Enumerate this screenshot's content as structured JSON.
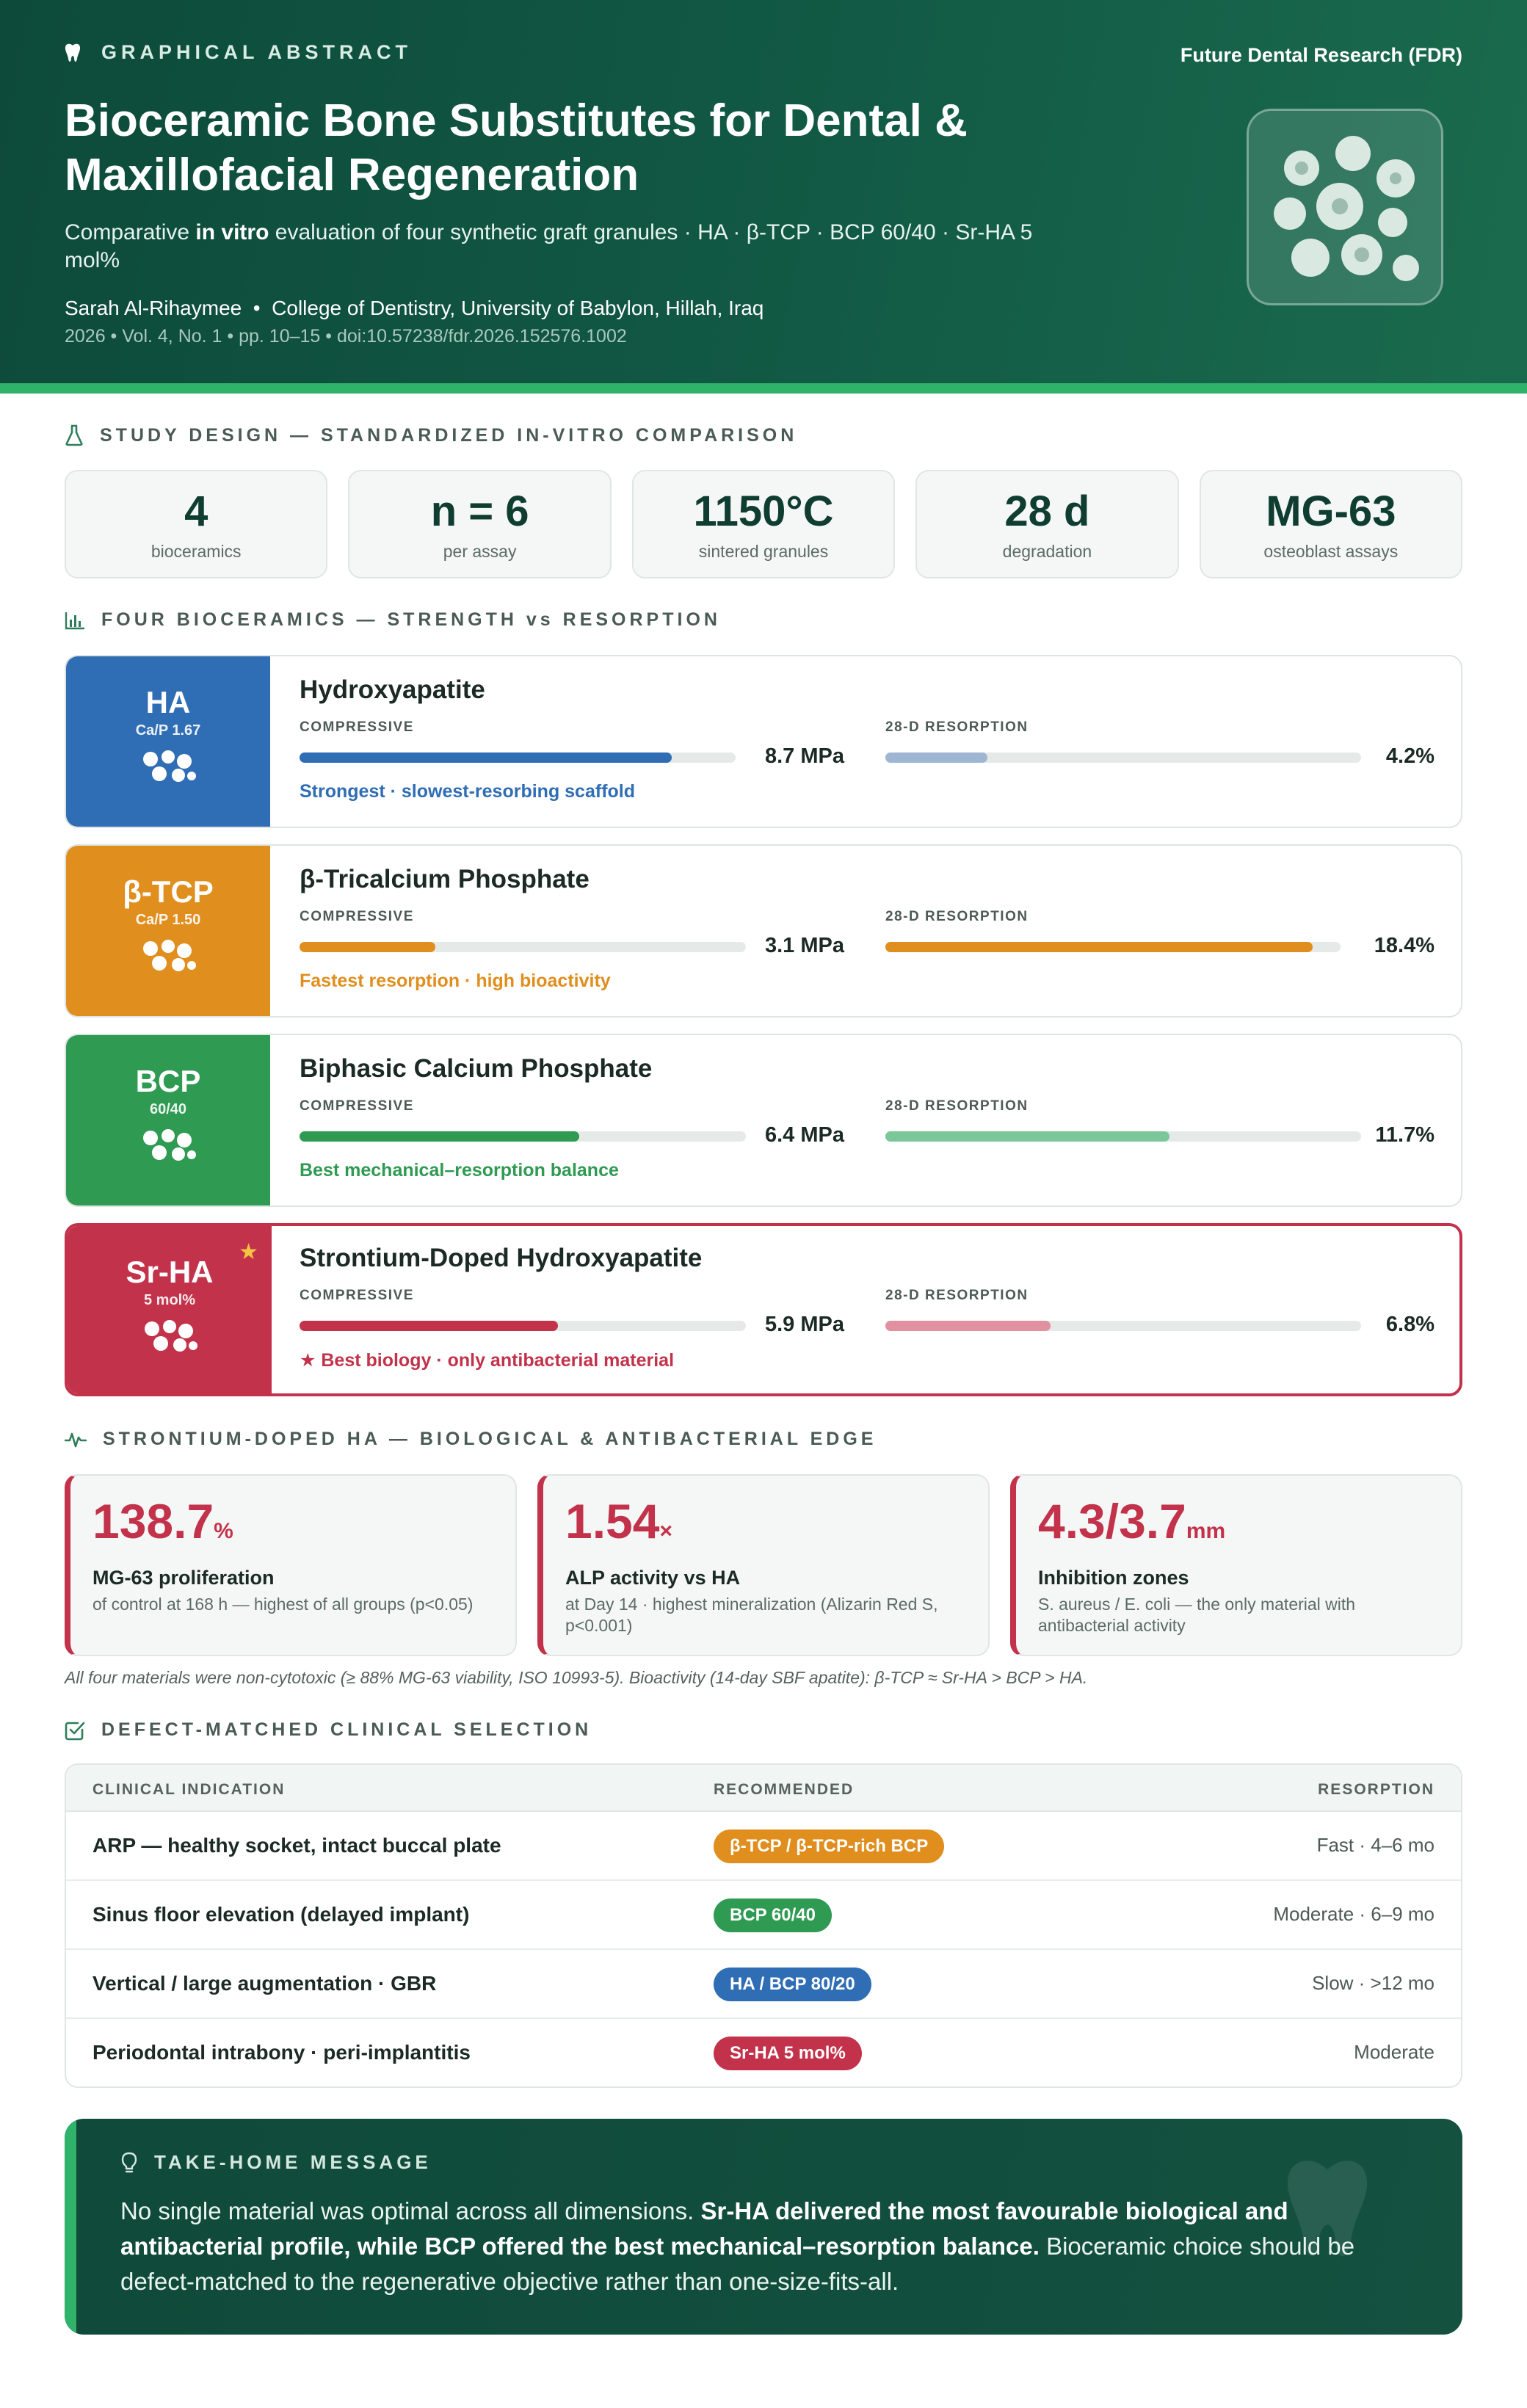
{
  "header": {
    "section_label": "GRAPHICAL ABSTRACT",
    "journal": "Future Dental Research (FDR)",
    "title": "Bioceramic Bone Substitutes for Dental & Maxillofacial Regeneration",
    "subtitle_pre": "Comparative ",
    "subtitle_bold": "in vitro",
    "subtitle_post": " evaluation of four synthetic graft granules  ·  HA · β-TCP · BCP 60/40 · Sr-HA 5 mol%",
    "author": "Sarah Al-Rihaymee",
    "affiliation": "College of Dentistry, University of Babylon, Hillah, Iraq",
    "author_sep": "•",
    "citation": "2026  •  Vol. 4, No. 1  •  pp. 10–15  •  doi:10.57238/fdr.2026.152576.1002"
  },
  "study_design": {
    "heading": "STUDY DESIGN — STANDARDIZED IN-VITRO COMPARISON",
    "stats": [
      {
        "value": "4",
        "label": "bioceramics"
      },
      {
        "value": "n = 6",
        "label": "per assay"
      },
      {
        "value": "1150°C",
        "label": "sintered granules"
      },
      {
        "value": "28 d",
        "label": "degradation"
      },
      {
        "value": "MG-63",
        "label": "osteoblast assays"
      }
    ]
  },
  "materials_section": {
    "heading": "FOUR BIOCERAMICS — STRENGTH vs RESORPTION",
    "compressive_label": "COMPRESSIVE",
    "resorption_label": "28-D RESORPTION"
  },
  "materials": [
    {
      "abbr": "HA",
      "sub": "Ca/P 1.67",
      "name": "Hydroxyapatite",
      "compressive_mpa": 8.7,
      "compressive_text": "8.7 MPa",
      "resorption_pct": 4.2,
      "resorption_text": "4.2%",
      "note": "Strongest · slowest-resorbing scaffold",
      "color": "#2f6db5",
      "light": "#9fb6d2"
    },
    {
      "abbr": "β-TCP",
      "sub": "Ca/P 1.50",
      "name": "β-Tricalcium Phosphate",
      "compressive_mpa": 3.1,
      "compressive_text": "3.1 MPa",
      "resorption_pct": 18.4,
      "resorption_text": "18.4%",
      "note": "Fastest resorption · high bioactivity",
      "color": "#e08e1e",
      "light": "#e08e1e"
    },
    {
      "abbr": "BCP",
      "sub": "60/40",
      "name": "Biphasic Calcium Phosphate",
      "compressive_mpa": 6.4,
      "compressive_text": "6.4 MPa",
      "resorption_pct": 11.7,
      "resorption_text": "11.7%",
      "note": "Best mechanical–resorption balance",
      "color": "#2e9a52",
      "light": "#7cc79a"
    },
    {
      "abbr": "Sr-HA",
      "sub": "5 mol%",
      "name": "Strontium-Doped Hydroxyapatite",
      "compressive_mpa": 5.9,
      "compressive_text": "5.9 MPa",
      "resorption_pct": 6.8,
      "resorption_text": "6.8%",
      "note": "★ Best biology · only antibacterial material",
      "color": "#c3324b",
      "light": "#e0909e",
      "star": "★"
    }
  ],
  "srha_section": {
    "heading": "STRONTIUM-DOPED HA — BIOLOGICAL & ANTIBACTERIAL EDGE",
    "cards": [
      {
        "value": "138.7",
        "unit": "%",
        "title": "MG-63 proliferation",
        "desc": "of control at 168 h — highest of all groups (p<0.05)"
      },
      {
        "value": "1.54",
        "unit": "×",
        "title": "ALP activity vs HA",
        "desc": "at Day 14 · highest mineralization (Alizarin Red S, p<0.001)"
      },
      {
        "value": "4.3/3.7",
        "unit": "mm",
        "title": "Inhibition zones",
        "desc": "S. aureus / E. coli — the only material with antibacterial activity"
      }
    ],
    "footnote": "All four materials were non-cytotoxic (≥ 88% MG-63 viability, ISO 10993-5). Bioactivity (14-day SBF apatite): β-TCP ≈ Sr-HA > BCP > HA."
  },
  "clinical": {
    "heading": "DEFECT-MATCHED CLINICAL SELECTION",
    "columns": [
      "CLINICAL INDICATION",
      "RECOMMENDED",
      "RESORPTION"
    ],
    "rows": [
      {
        "indication": "ARP — healthy socket, intact buccal plate",
        "recommended": "β-TCP / β-TCP-rich BCP",
        "resorption": "Fast · 4–6 mo",
        "color": "#e08e1e"
      },
      {
        "indication": "Sinus floor elevation (delayed implant)",
        "recommended": "BCP 60/40",
        "resorption": "Moderate · 6–9 mo",
        "color": "#2e9a52"
      },
      {
        "indication": "Vertical / large augmentation · GBR",
        "recommended": "HA / BCP 80/20",
        "resorption": "Slow · >12 mo",
        "color": "#2f6db5"
      },
      {
        "indication": "Periodontal intrabony · peri-implantitis",
        "recommended": "Sr-HA 5 mol%",
        "resorption": "Moderate",
        "color": "#c3324b"
      }
    ]
  },
  "takehome": {
    "heading": "TAKE-HOME MESSAGE",
    "pre": "No single material was optimal across all dimensions. ",
    "bold": "Sr-HA delivered the most favourable biological and antibacterial profile, while BCP offered the best mechanical–resorption balance.",
    "post": " Bioceramic choice should be defect-matched to the regenerative objective rather than one-size-fits-all."
  },
  "colors": {
    "brand_dark": "#0d4a3a",
    "brand_accent": "#2fb26a",
    "highlight": "#c3324b"
  }
}
